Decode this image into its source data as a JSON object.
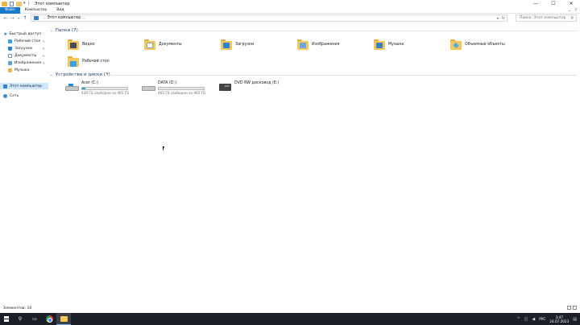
{
  "window": {
    "title": "Этот компьютер",
    "controls": {
      "minimize": "—",
      "maximize": "☐",
      "close": "✕"
    }
  },
  "ribbon": {
    "tabs": [
      "Файл",
      "Компьютер",
      "Вид"
    ]
  },
  "address": {
    "path": "Этот компьютер",
    "search_placeholder": "Поиск: Этот компьютер"
  },
  "nav": {
    "quick_access": "Быстрый доступ",
    "items": [
      "Рабочий стол",
      "Загрузки",
      "Документы",
      "Изображения",
      "Музыка"
    ],
    "this_pc": "Этот компьютер",
    "network": "Сеть"
  },
  "folders": {
    "header": "Папки (7)",
    "items": [
      {
        "label": "Видео",
        "icon": "video-folder-icon"
      },
      {
        "label": "Документы",
        "icon": "documents-folder-icon"
      },
      {
        "label": "Загрузки",
        "icon": "downloads-folder-icon"
      },
      {
        "label": "Изображения",
        "icon": "pictures-folder-icon"
      },
      {
        "label": "Музыка",
        "icon": "music-folder-icon"
      },
      {
        "label": "Объемные объекты",
        "icon": "3d-objects-folder-icon"
      },
      {
        "label": "Рабочий стол",
        "icon": "desktop-folder-icon"
      }
    ]
  },
  "drives": {
    "header": "Устройства и диски (3)",
    "items": [
      {
        "name": "Acer (C:)",
        "free": "430 ГБ свободно из 465 ГБ",
        "used_fraction": 0.075
      },
      {
        "name": "DATA (D:)",
        "free": "465 ГБ свободно из 465 ГБ",
        "used_fraction": 0.0
      },
      {
        "name": "DVD RW дисковод (E:)"
      }
    ]
  },
  "status": {
    "items_count": "Элементов: 10"
  },
  "taskbar": {
    "lang": "РУС",
    "time": "3:47",
    "date": "24.07.2023"
  },
  "colors": {
    "accent": "#1979ca",
    "selected_nav": "#cce8ff",
    "drive_fill": "#26a0da",
    "taskbar": "#1b1f27"
  }
}
